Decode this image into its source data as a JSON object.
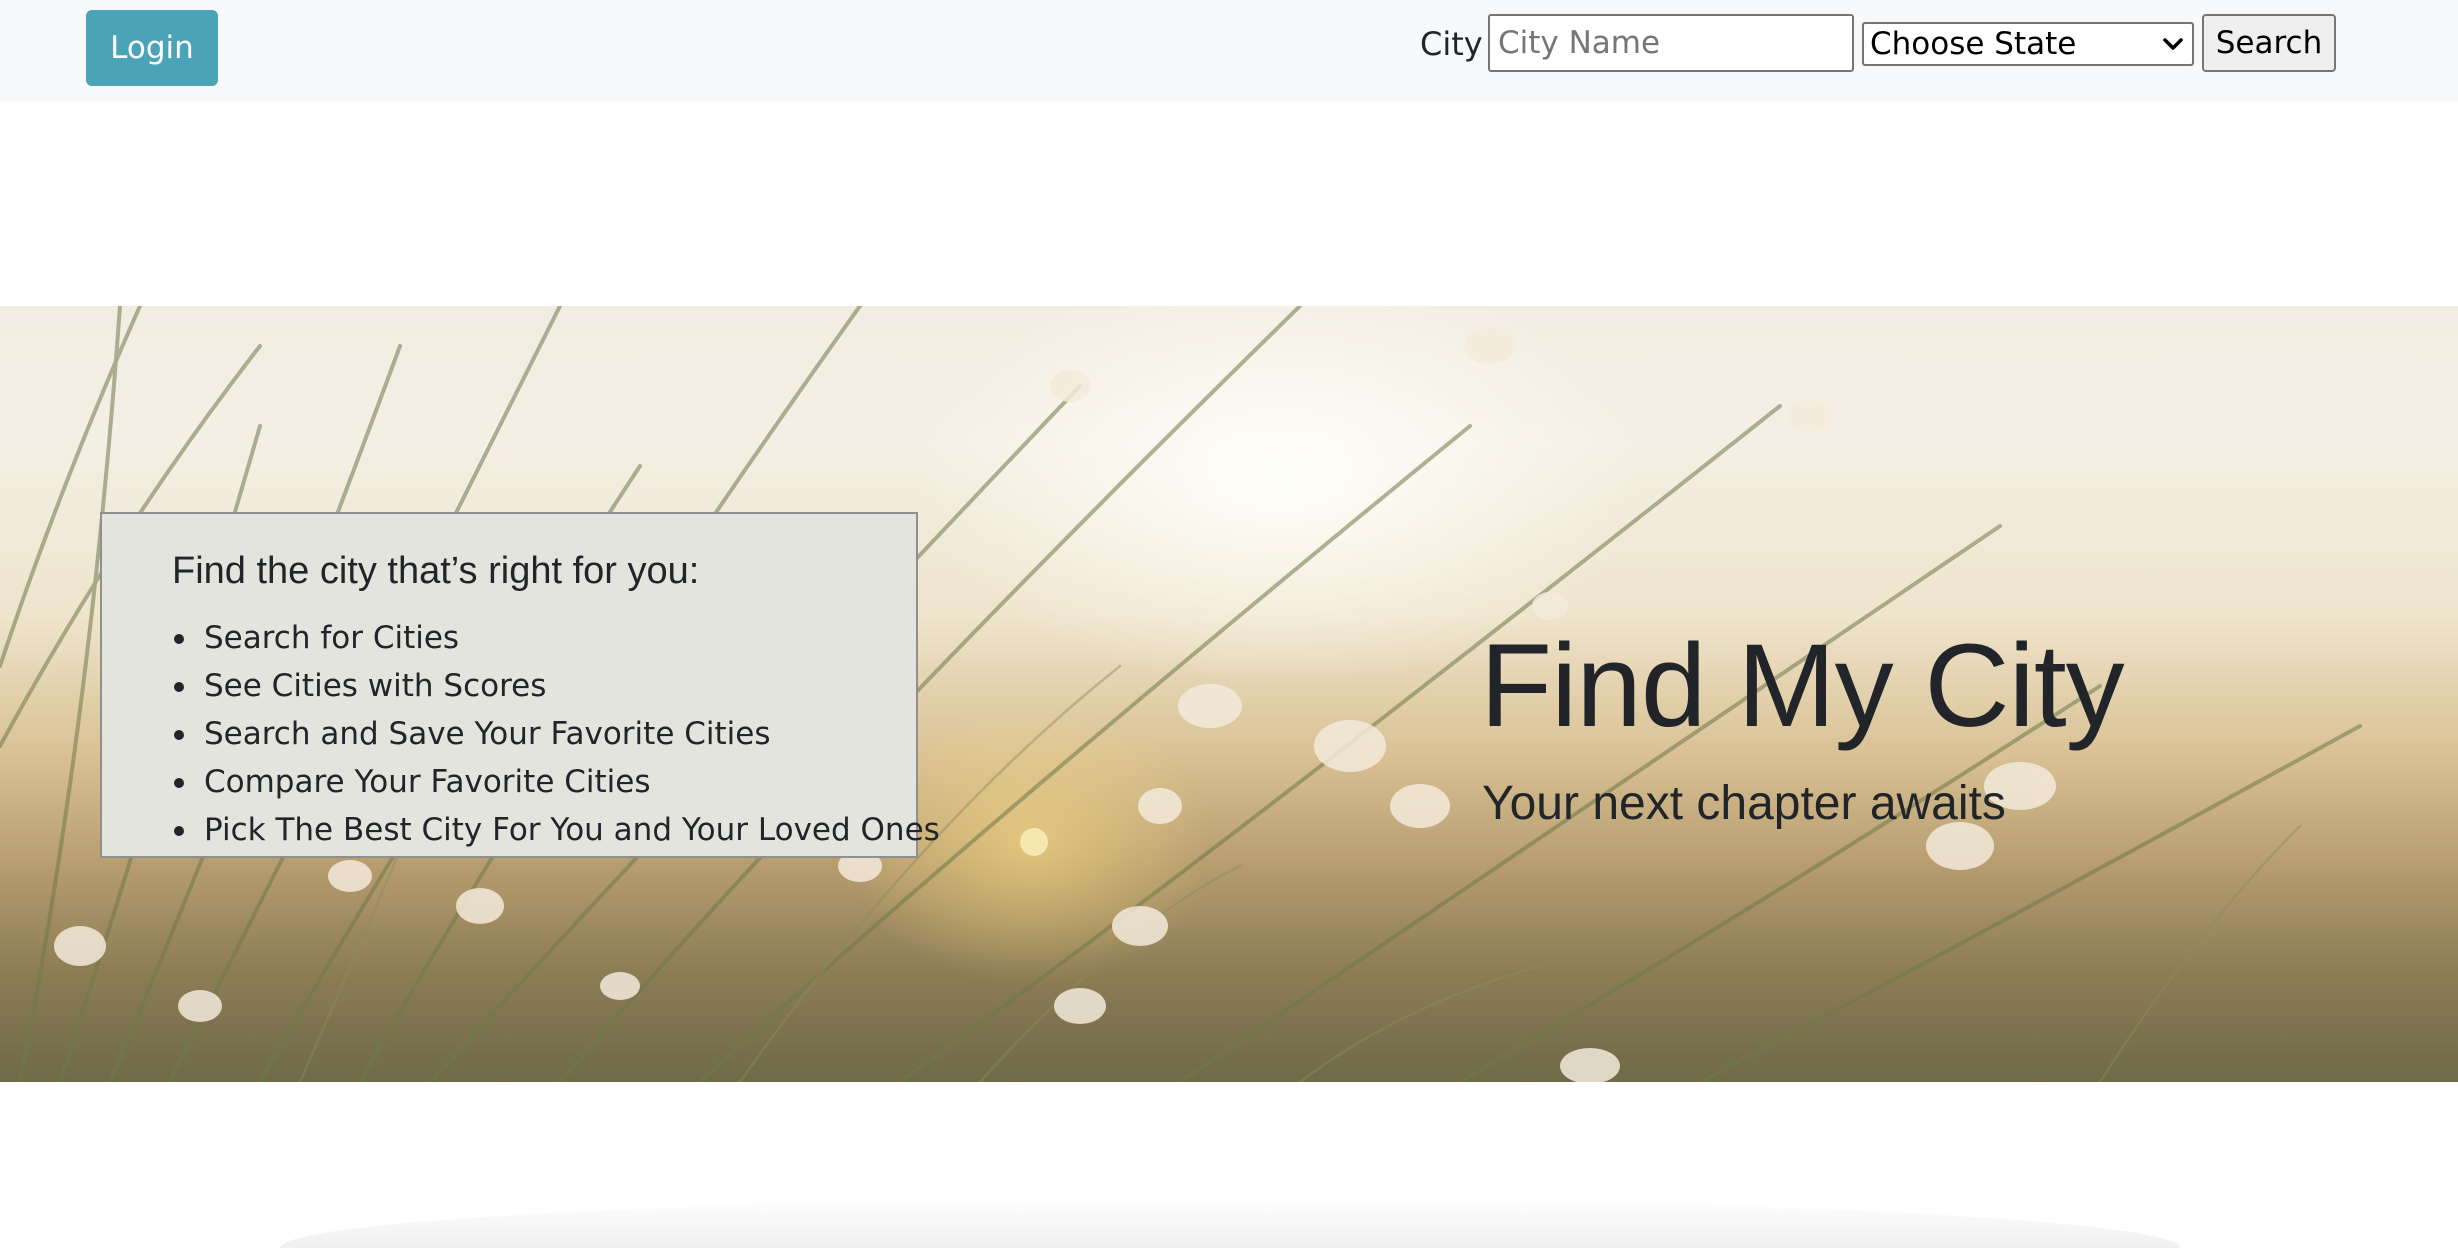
{
  "navbar": {
    "login_label": "Login",
    "city_label": "City",
    "city_input": {
      "value": "",
      "placeholder": "City Name"
    },
    "state_select": {
      "selected": "Choose State"
    },
    "search_label": "Search",
    "background_color": "#f8f9fa",
    "login_color": "#4ba3b7"
  },
  "hero": {
    "title": "Find My City",
    "subtitle": "Your next chapter awaits",
    "info_box": {
      "heading": "Find the city that’s right for you:",
      "items": [
        "Search for Cities",
        "See Cities with Scores",
        "Search and Save Your Favorite Cities",
        "Compare Your Favorite Cities",
        "Pick The Best City For You and Your Loved Ones"
      ]
    }
  },
  "icons": {
    "select_arrow": "chevron-down-icon"
  }
}
